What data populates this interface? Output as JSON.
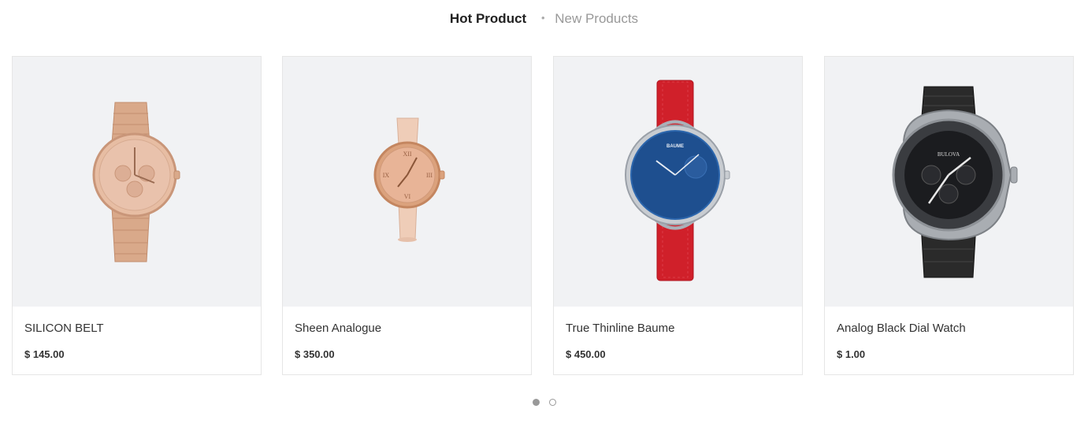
{
  "tabs": [
    {
      "label": "Hot Product",
      "active": true
    },
    {
      "label": "New Products",
      "active": false
    }
  ],
  "tab_separator": "•",
  "products": [
    {
      "name": "SILICON BELT",
      "price": "$ 145.00",
      "image": "rose-gold-metal-watch"
    },
    {
      "name": "Sheen Analogue",
      "price": "$ 350.00",
      "image": "pink-leather-watch"
    },
    {
      "name": "True Thinline Baume",
      "price": "$ 450.00",
      "image": "blue-dial-red-strap-watch",
      "dial_brand": "BAUME"
    },
    {
      "name": "Analog Black Dial Watch",
      "price": "$ 1.00",
      "image": "black-dial-chronograph-watch",
      "dial_brand": "BULOVA"
    }
  ],
  "carousel": {
    "pages": 2,
    "current": 1
  },
  "colors": {
    "image_bg": "#f1f2f4",
    "border": "#e6e6e6",
    "text": "#333333",
    "muted": "#999999"
  }
}
